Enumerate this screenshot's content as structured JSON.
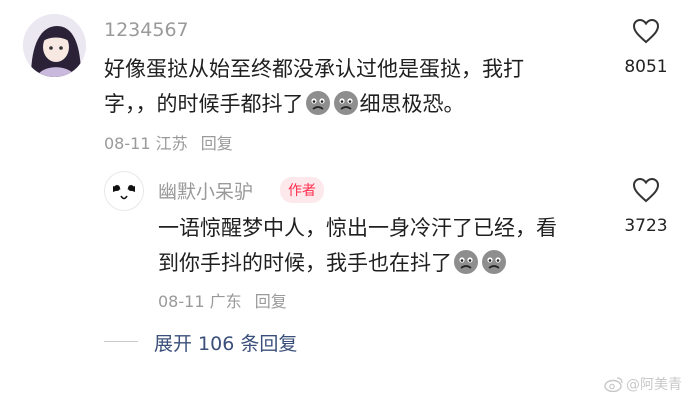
{
  "comment": {
    "username": "1234567",
    "text_line1": "好像蛋挞从始至终都没承认过他是蛋挞，我打",
    "text_line2": "字，，的时候手都抖了",
    "text_line2_tail": "细思极恐。",
    "date": "08-11",
    "location": "江苏",
    "reply_label": "回复",
    "like_count": "8051"
  },
  "reply": {
    "username": "幽默小呆驴",
    "badge": "作者",
    "text_line1": "一语惊醒梦中人，惊出一身冷汗了已经，看",
    "text_line2": "到你手抖的时候，我手也在抖了",
    "date": "08-11",
    "location": "广东",
    "reply_label": "回复",
    "like_count": "3723"
  },
  "expand_replies": "展开 106 条回复",
  "watermark": "@阿美青",
  "icons": {
    "like": "heart-outline-icon",
    "emoji": "sad-face-emoji-icon",
    "weibo": "weibo-logo-icon"
  }
}
